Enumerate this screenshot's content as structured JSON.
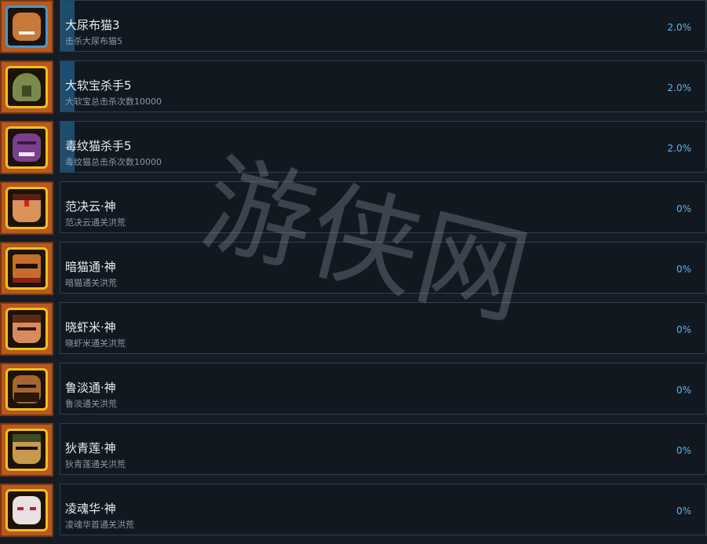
{
  "achievements": [
    {
      "title": "大尿布猫3",
      "description": "击杀大尿布猫5",
      "percent": "2.0%",
      "progress": 0.02,
      "icon": "diaper-cat-icon",
      "frame_color": "#3f9bd8",
      "face_color": "#c77a3a"
    },
    {
      "title": "大软宝杀手5",
      "description": "大软宝总击杀次数10000",
      "percent": "2.0%",
      "progress": 0.02,
      "icon": "slime-boss-icon",
      "frame_color": "#f2c018",
      "face_color": "#7b8a4c"
    },
    {
      "title": "毒纹猫杀手5",
      "description": "毒纹猫总击杀次数10000",
      "percent": "2.0%",
      "progress": 0.02,
      "icon": "poison-cat-icon",
      "frame_color": "#f2c018",
      "face_color": "#7a3f8e"
    },
    {
      "title": "范决云·神",
      "description": "范决云通关洪荒",
      "percent": "0%",
      "progress": 0,
      "icon": "fan-jueyun-portrait-icon",
      "frame_color": "#f2c018",
      "face_color": "#d9925a"
    },
    {
      "title": "暗猫通·神",
      "description": "暗猫通关洪荒",
      "percent": "0%",
      "progress": 0,
      "icon": "dark-cat-portrait-icon",
      "frame_color": "#f2c018",
      "face_color": "#c56d2e"
    },
    {
      "title": "晓虾米·神",
      "description": "晓虾米通关洪荒",
      "percent": "0%",
      "progress": 0,
      "icon": "xiao-xiami-portrait-icon",
      "frame_color": "#f2c018",
      "face_color": "#d98b5e"
    },
    {
      "title": "鲁淡通·神",
      "description": "鲁淡通关洪荒",
      "percent": "0%",
      "progress": 0,
      "icon": "lu-dan-portrait-icon",
      "frame_color": "#f2c018",
      "face_color": "#a8642f"
    },
    {
      "title": "狄青莲·神",
      "description": "狄青莲通关洪荒",
      "percent": "0%",
      "progress": 0,
      "icon": "di-qinglian-portrait-icon",
      "frame_color": "#f2c018",
      "face_color": "#c9994e"
    },
    {
      "title": "凌魂华·神",
      "description": "凌魂华首通关洪荒",
      "percent": "0%",
      "progress": 0,
      "icon": "ling-hunhua-portrait-icon",
      "frame_color": "#f2c018",
      "face_color": "#e8e2e2"
    }
  ],
  "watermark": "游侠网"
}
